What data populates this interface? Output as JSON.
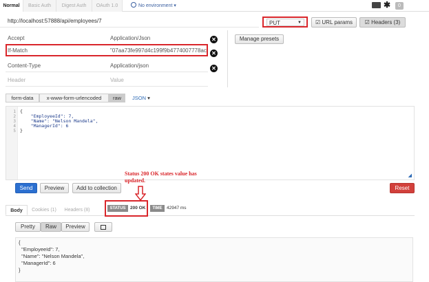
{
  "auth_tabs": [
    "Normal",
    "Basic Auth",
    "Digest Auth",
    "OAuth 1.0"
  ],
  "environment": "No environment",
  "badge_count": "0",
  "request": {
    "url": "http://localhost:57888/api/employees/7",
    "method": "PUT",
    "url_params_label": "URL params",
    "headers_label": "Headers (3)"
  },
  "headers": [
    {
      "key": "Accept",
      "value": "Application/Json"
    },
    {
      "key": "If-Match",
      "value": "\"07aa73fe997d4c199f9b4774007778ac"
    },
    {
      "key": "Content-Type",
      "value": "Application/json"
    }
  ],
  "header_placeholders": {
    "key": "Header",
    "value": "Value"
  },
  "manage_presets_label": "Manage presets",
  "body_tabs": [
    "form-data",
    "x-www-form-urlencoded",
    "raw"
  ],
  "body_format": "JSON",
  "request_body_lines": [
    "{",
    "    \"EmployeeId\": 7,",
    "    \"Name\": \"Nelson Mandela\",",
    "    \"ManagerId\": 6",
    "}"
  ],
  "line_numbers": [
    "1",
    "2",
    "3",
    "4",
    "5"
  ],
  "annotation": {
    "line1": "Status 200 OK states value has",
    "line2": "updated."
  },
  "actions": {
    "send": "Send",
    "preview": "Preview",
    "add_to_collection": "Add to collection",
    "reset": "Reset"
  },
  "response_tabs": [
    "Body",
    "Cookies (1)",
    "Headers (8)"
  ],
  "status": {
    "label": "STATUS",
    "value": "200 OK",
    "time_label": "TIME",
    "time_value": "42947 ms"
  },
  "view_modes": [
    "Pretty",
    "Raw",
    "Preview"
  ],
  "response_body_lines": [
    "{",
    "  \"EmployeeId\": 7,",
    "  \"Name\": \"Nelson Mandela\",",
    "  \"ManagerId\": 6",
    "}"
  ],
  "colors": {
    "accent_red": "#d9252a",
    "send_blue": "#2b6fd0",
    "reset_red": "#d2403b"
  }
}
